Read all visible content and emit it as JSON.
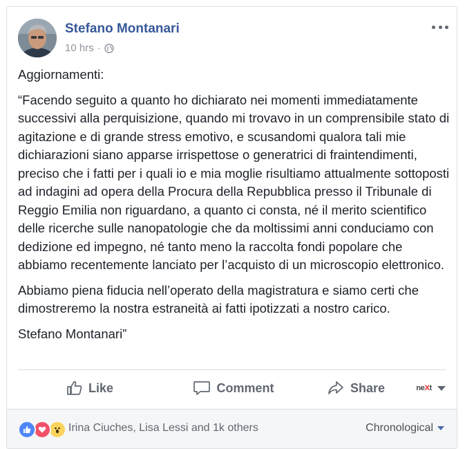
{
  "post": {
    "author": "Stefano Montanari",
    "time": "10 hrs",
    "separator": "·",
    "privacy_icon": "globe-icon",
    "paragraphs": [
      "Aggiornamenti:",
      "“Facendo seguito a quanto ho dichiarato nei momenti immediatamente successivi alla perquisizione, quando mi trovavo in un comprensibile stato di agitazione e di grande stress emotivo, e scusandomi qualora tali mie dichiarazioni siano apparse irrispettose o generatrici di fraintendimenti, preciso che i fatti per i quali io e mia moglie risultiamo attualmente sottoposti ad indagini ad opera della Procura della Repubblica presso il Tribunale di Reggio Emilia non riguardano, a quanto ci consta, né il merito scientifico delle ricerche sulle nanopatologie che da moltissimi anni conduciamo con dedizione ed impegno, né tanto meno la raccolta fondi popolare che abbiamo recentemente lanciato per l’acquisto di un microscopio elettronico.",
      "Abbiamo piena fiducia nell’operato della magistratura e siamo certi che dimostreremo la nostra estraneità ai fatti ipotizzati a nostro carico.",
      "Stefano Montanari”"
    ]
  },
  "actions": {
    "like": "Like",
    "comment": "Comment",
    "share": "Share",
    "next_logo_a": "ne",
    "next_logo_x": "X",
    "next_logo_b": "t"
  },
  "footer": {
    "reactions": [
      "like-reaction-icon",
      "love-reaction-icon",
      "wow-reaction-icon"
    ],
    "names": "Irina Ciuches, Lisa Lessi and 1k others",
    "sort": "Chronological"
  },
  "colors": {
    "link": "#365899",
    "meta": "#90949c",
    "action": "#606770",
    "footer_bg": "#f5f6f7"
  }
}
